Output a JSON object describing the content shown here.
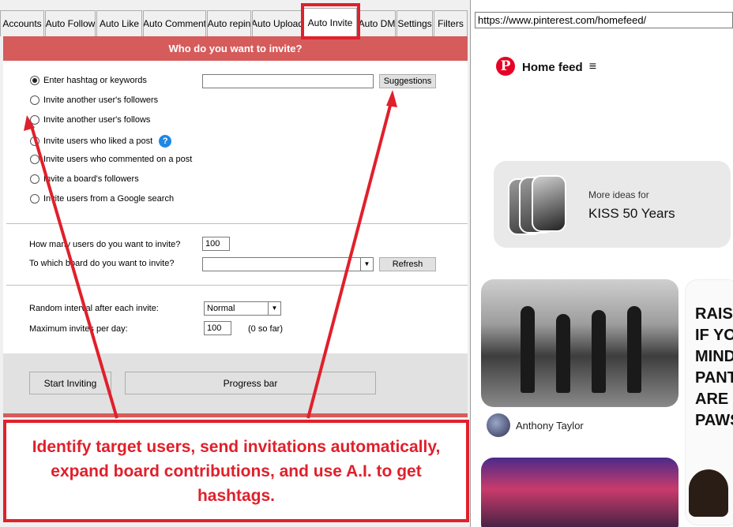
{
  "app": {
    "tabs": [
      {
        "label": "Accounts"
      },
      {
        "label": "Auto Follow"
      },
      {
        "label": "Auto Like"
      },
      {
        "label": "Auto Comment"
      },
      {
        "label": "Auto repin"
      },
      {
        "label": "Auto Upload"
      },
      {
        "label": "Auto Invite",
        "active": true
      },
      {
        "label": "Auto DM"
      },
      {
        "label": "Settings"
      },
      {
        "label": "Filters"
      }
    ],
    "header_title": "Who do you want to invite?",
    "invite_options": [
      {
        "label": "Enter hashtag or keywords",
        "checked": true
      },
      {
        "label": "Invite another user's followers",
        "checked": false
      },
      {
        "label": "Invite another user's follows",
        "checked": false
      },
      {
        "label": "Invite users who liked a post",
        "checked": false
      },
      {
        "label": "Invite users who commented on a post",
        "checked": false
      },
      {
        "label": "Invite a board's followers",
        "checked": false
      },
      {
        "label": "Invite users from a Google search",
        "checked": false
      }
    ],
    "hashtag_input_value": "",
    "suggestions_button": "Suggestions",
    "help_glyph": "?",
    "how_many_label": "How many users do you want to invite?",
    "how_many_value": "100",
    "board_label": "To which board do you want to invite?",
    "board_value": "",
    "refresh_button": "Refresh",
    "random_interval_label": "Random interval after each invite:",
    "random_interval_value": "Normal",
    "max_invites_label": "Maximum invites per day:",
    "max_invites_value": "100",
    "max_invites_note": "(0 so far)",
    "start_button": "Start Inviting",
    "progress_label": "Progress bar"
  },
  "browser": {
    "url": "https://www.pinterest.com/homefeed/",
    "logo_glyph": "P",
    "home_feed_label": "Home feed",
    "ideas_subtitle": "More ideas for",
    "ideas_title": "KISS 50 Years",
    "pin_author": "Anthony Taylor",
    "side_pin_text": "RAISE\nIF YOU\nMIND\nPANTS\nARE\nPAWS"
  },
  "callout_text": "Identify target users, send invitations automatically, expand board contributions, and use A.I. to get hashtags.",
  "colors": {
    "accent_red": "#e0202b",
    "header_red": "#d65b5b",
    "pinterest_red": "#e60023",
    "help_blue": "#1e88e5"
  }
}
